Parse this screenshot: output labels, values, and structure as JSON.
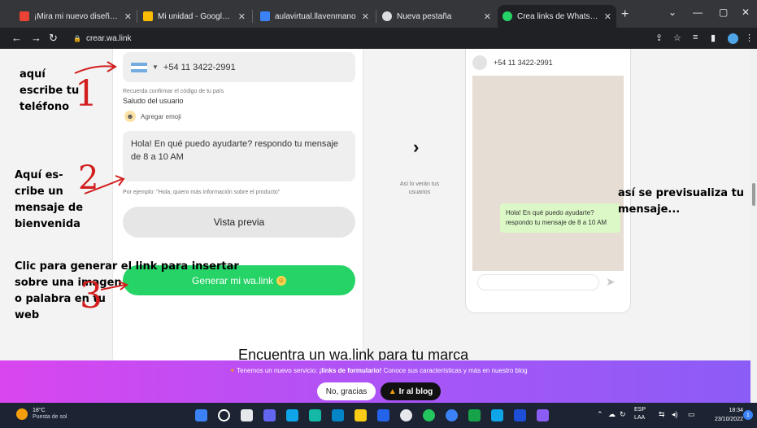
{
  "browser": {
    "tabs": [
      {
        "title": "¡Mira mi nuevo diseño hecho",
        "icon": "gmail-icon",
        "color": "#ea4335"
      },
      {
        "title": "Mi unidad - Google Drive",
        "icon": "drive-icon",
        "color": "#fbbc04"
      },
      {
        "title": "aulavirtual.llavenmano",
        "icon": "aula-icon",
        "color": "#3b82f6"
      },
      {
        "title": "Nueva pestaña",
        "icon": "chrome-icon",
        "color": "#dadce0"
      },
      {
        "title": "Crea links de WhatsApp | Wa",
        "icon": "whatsapp-icon",
        "color": "#25d366"
      }
    ],
    "url": "crear.wa.link"
  },
  "form": {
    "phone_value": "+54 11 3422-2991",
    "phone_note": "Recuerda confirmar el código de tu país",
    "greeting_label": "Saludo del usuario",
    "emoji_label": "Agregar emoji",
    "message_value": "Hola! En qué puedo ayudarte? respondo tu mensaje de 8 a 10  AM",
    "example_note": "Por ejemplo: \"Hola, quiero más información sobre el producto\"",
    "preview_button": "Vista previa",
    "generate_button": "Generar mi wa.link"
  },
  "preview": {
    "caption": "Así lo verán tus usuarios",
    "contact": "+54 11 3422-2991",
    "bubble_text": "Hola! En qué puedo ayudarte? respondo tu mensaje de 8 a 10 AM"
  },
  "page": {
    "headline": "Encuentra un wa.link para tu marca"
  },
  "annotations": {
    "phone": "aquí escribe tu teléfono",
    "welcome": "Aquí es- cribe un mensaje de bienvenida",
    "generate_line1": "Clic para generar el link para insertar",
    "generate_rest": "sobre una imagen o palabra en tu web",
    "preview": "así se previsualiza tu mensaje...",
    "numbers": [
      "1",
      "2",
      "3"
    ]
  },
  "banner": {
    "text_pre": "Tenemos un nuevo servicio: ",
    "text_bold": "¡links de formulario!",
    "text_post": " Conoce sus características y más en nuestro blog",
    "no_button": "No, gracias",
    "blog_button": "Ir al blog"
  },
  "taskbar": {
    "temp": "18°C",
    "weather": "Puesta de sol",
    "lang1": "ESP",
    "lang2": "LAA",
    "time": "18:34",
    "date": "23/10/2022",
    "notif_count": "1"
  }
}
